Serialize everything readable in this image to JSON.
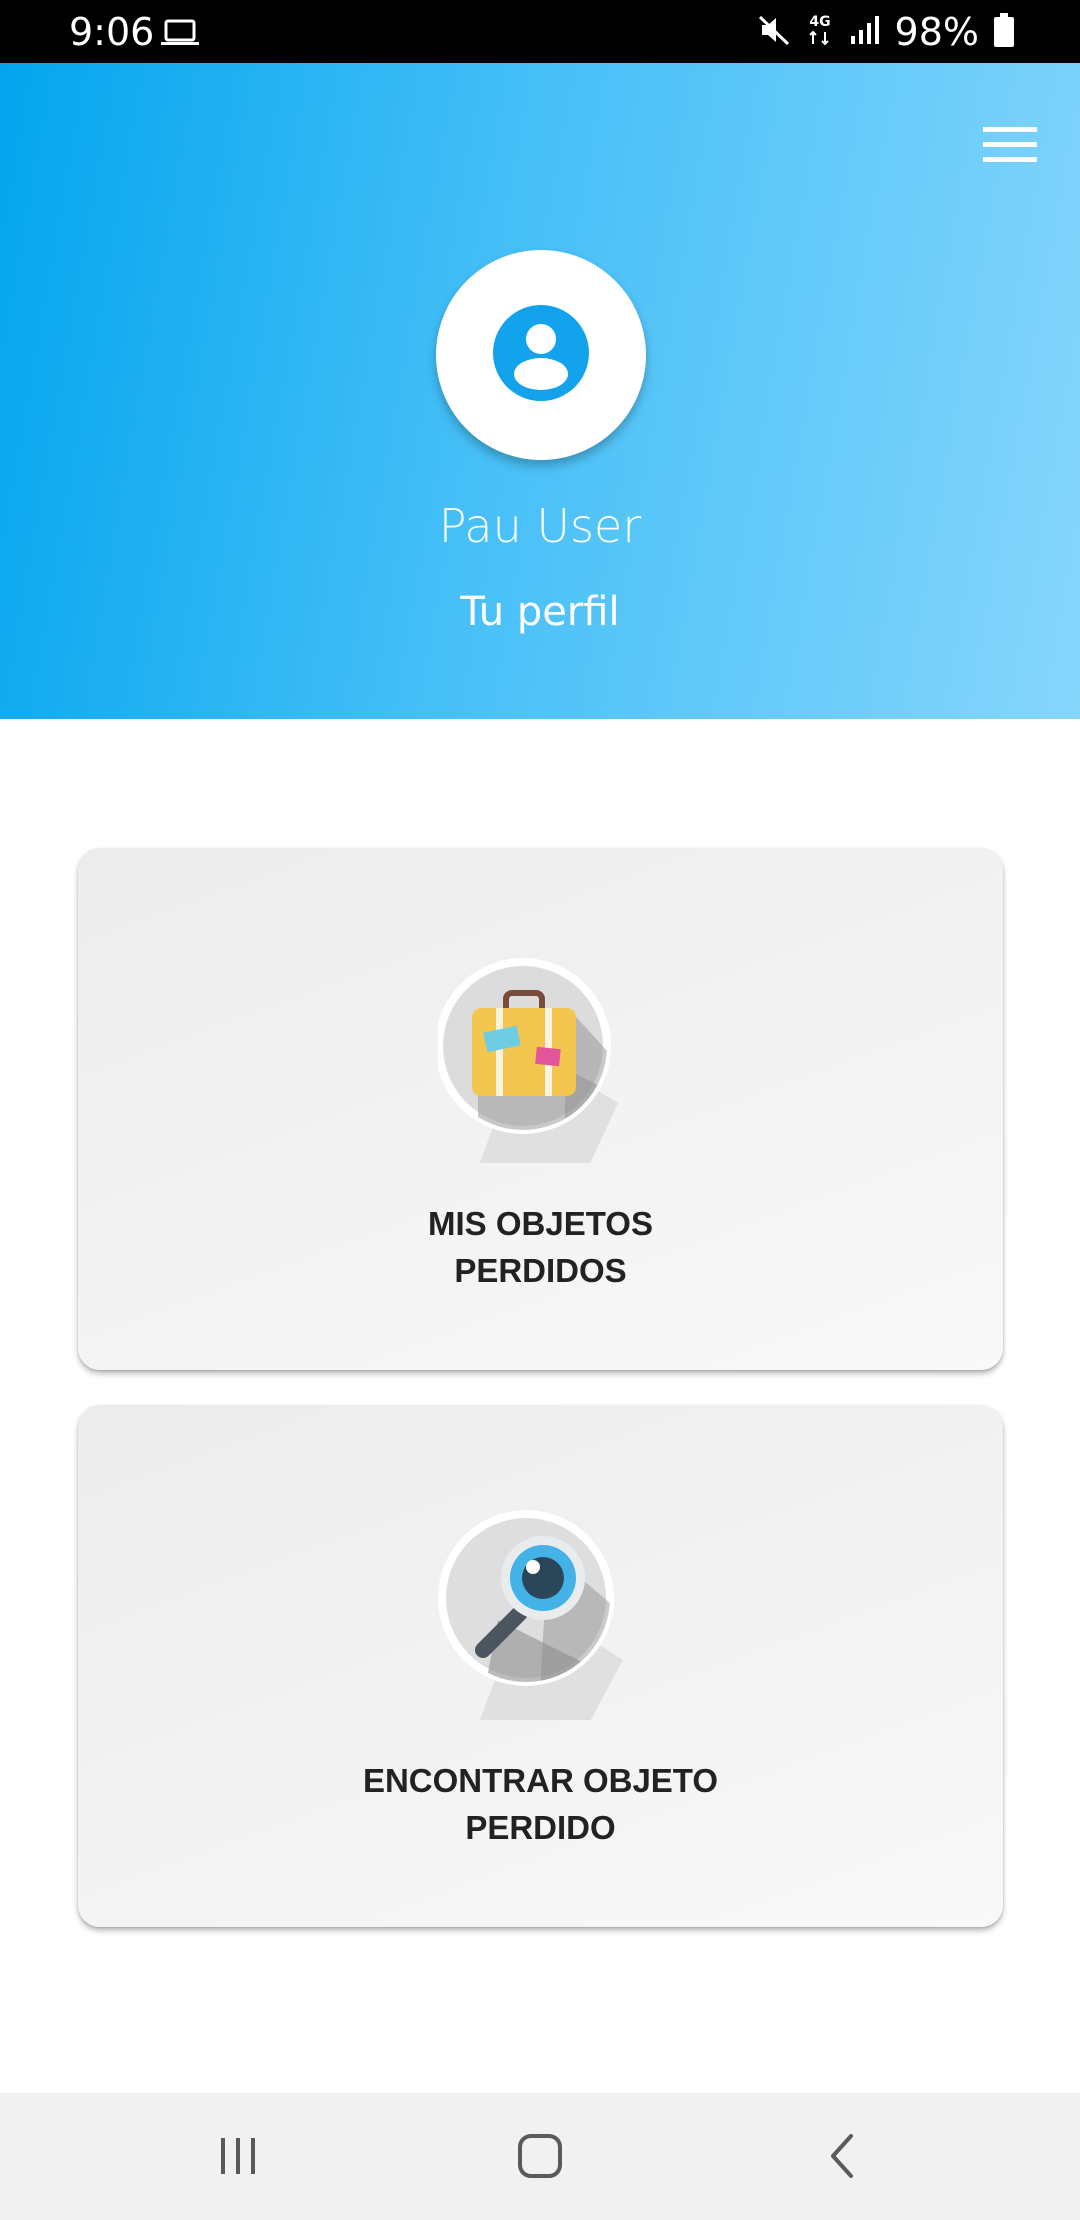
{
  "status_bar": {
    "time": "9:06",
    "battery": "98%",
    "network": "4G",
    "icons": [
      "laptop-icon",
      "mute-icon",
      "4g-icon",
      "signal-icon",
      "battery-icon"
    ]
  },
  "header": {
    "user_name": "Pau User",
    "profile_link": "Tu perfil",
    "menu_icon": "hamburger-menu-icon",
    "avatar_icon": "account-circle-icon",
    "gradient_colors": [
      "#03a5ee",
      "#86d6fc"
    ]
  },
  "cards": [
    {
      "icon": "suitcase-icon",
      "title_line1": "MIS OBJETOS",
      "title_line2": "PERDIDOS"
    },
    {
      "icon": "magnifier-eye-icon",
      "title_line1": "ENCONTRAR OBJETO",
      "title_line2": "PERDIDO"
    }
  ],
  "nav_bar": {
    "buttons": [
      "recents-icon",
      "home-icon",
      "back-icon"
    ]
  },
  "colors": {
    "accent": "#13a3ec",
    "card_text": "#222222",
    "nav_bg": "#f1f1f1"
  }
}
